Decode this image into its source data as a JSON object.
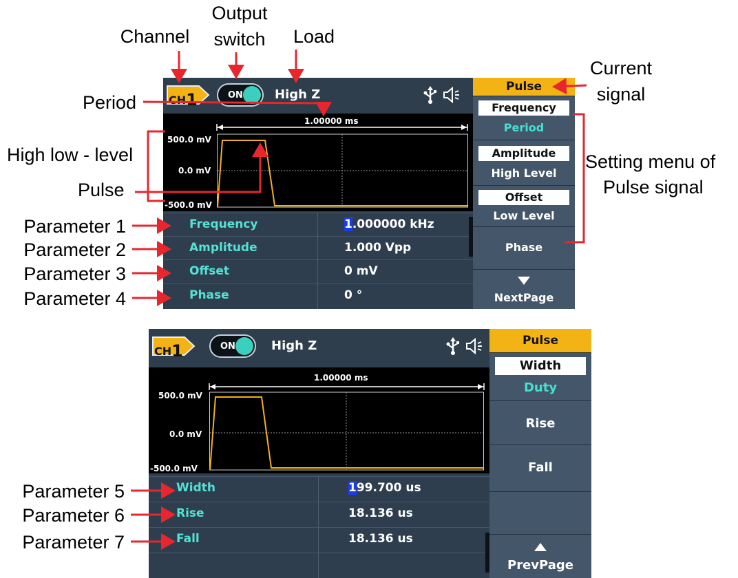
{
  "annotations": {
    "channel": "Channel",
    "output_switch_line1": "Output",
    "output_switch_line2": "switch",
    "load": "Load",
    "current_signal_line1": "Current",
    "current_signal_line2": "signal",
    "period": "Period",
    "high_low_level": "High low - level",
    "pulse": "Pulse",
    "setting_menu_line1": "Setting menu of",
    "setting_menu_line2": "Pulse signal",
    "parameter_1": "Parameter 1",
    "parameter_2": "Parameter 2",
    "parameter_3": "Parameter 3",
    "parameter_4": "Parameter 4",
    "parameter_5": "Parameter 5",
    "parameter_6": "Parameter 6",
    "parameter_7": "Parameter 7"
  },
  "screen1": {
    "channel_prefix": "CH",
    "channel_number": "1",
    "output_state": "ON",
    "load": "High Z",
    "period_text": "1.00000 ms",
    "y_labels": [
      "500.0 mV",
      "0.0 mV",
      "-500.0 mV"
    ],
    "params": [
      {
        "name": "Frequency",
        "value_cursor": "1",
        "value_rest": ".000000 kHz"
      },
      {
        "name": "Amplitude",
        "value_cursor": "",
        "value_rest": "1.000 Vpp"
      },
      {
        "name": "Offset",
        "value_cursor": "",
        "value_rest": "0 mV"
      },
      {
        "name": "Phase",
        "value_cursor": "",
        "value_rest": "0 °"
      }
    ],
    "side_title": "Pulse",
    "menu": [
      {
        "top": "Frequency",
        "bottom": "Period"
      },
      {
        "top": "Amplitude",
        "bottom": "High Level"
      },
      {
        "top": "Offset",
        "bottom": "Low Level"
      },
      {
        "top": "",
        "bottom": "Phase"
      },
      {
        "top": "",
        "bottom": "NextPage"
      }
    ]
  },
  "screen2": {
    "channel_prefix": "CH",
    "channel_number": "1",
    "output_state": "ON",
    "load": "High Z",
    "period_text": "1.00000 ms",
    "y_labels": [
      "500.0 mV",
      "0.0 mV",
      "-500.0 mV"
    ],
    "params": [
      {
        "name": "Width",
        "value_cursor": "1",
        "value_rest": "99.700 us"
      },
      {
        "name": "Rise",
        "value_cursor": "",
        "value_rest": "18.136 us"
      },
      {
        "name": "Fall",
        "value_cursor": "",
        "value_rest": "18.136 us"
      }
    ],
    "side_title": "Pulse",
    "menu": [
      {
        "top": "Width",
        "bottom": "Duty"
      },
      {
        "top": "",
        "bottom": "Rise"
      },
      {
        "top": "",
        "bottom": "Fall"
      },
      {
        "top": "",
        "bottom": ""
      },
      {
        "top": "",
        "bottom": "PrevPage"
      }
    ]
  },
  "colors": {
    "arrow": "#e8262d",
    "waveform": "#f4b315",
    "accent_cyan": "#44e0d2",
    "panel": "#2e3e4f",
    "header_yellow": "#f4b315"
  },
  "icons": [
    "usb-icon",
    "speaker-icon",
    "down-triangle-icon",
    "up-triangle-icon",
    "channel-badge-icon",
    "toggle-icon"
  ]
}
